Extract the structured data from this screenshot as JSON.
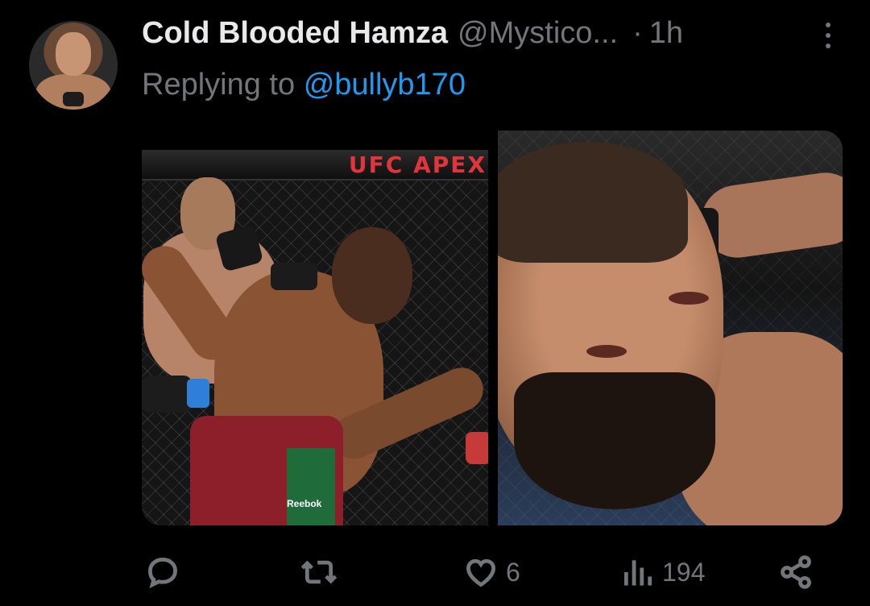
{
  "tweet": {
    "author_name": "Cold Blooded Hamza",
    "author_handle": "@Mystico...",
    "separator": "·",
    "time": "1h",
    "replying_prefix": "Replying to",
    "replying_to": "@bullyb170",
    "media": {
      "left_image_banner": "UFC APEX",
      "left_image_brand": "Reebok"
    },
    "actions": {
      "reply_count": "",
      "retweet_count": "",
      "like_count": "6",
      "views_count": "194"
    }
  },
  "icons": {
    "more": "more-vertical-icon",
    "reply": "reply-icon",
    "retweet": "retweet-icon",
    "like": "heart-icon",
    "views": "views-icon",
    "share": "share-icon"
  },
  "colors": {
    "background": "#000000",
    "text_primary": "#e7e9ea",
    "text_secondary": "#71767b",
    "link": "#1d9bf0",
    "banner_red": "#e0353d"
  }
}
